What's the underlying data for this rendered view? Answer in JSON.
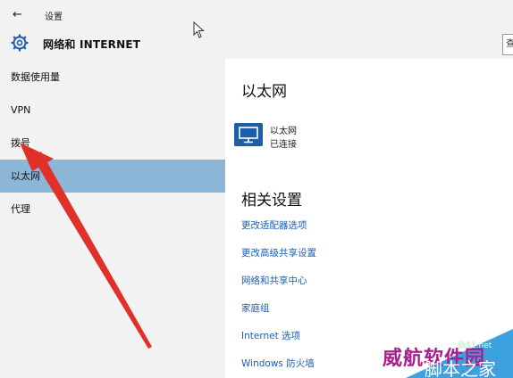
{
  "window": {
    "app_title": "设置",
    "section_title": "网络和 INTERNET",
    "back_icon": "back-arrow-icon",
    "gear_icon": "gear-icon"
  },
  "sidebar": {
    "items": [
      {
        "label": "数据使用量",
        "active": false
      },
      {
        "label": "VPN",
        "active": false
      },
      {
        "label": "拨号",
        "active": false
      },
      {
        "label": "以太网",
        "active": true
      },
      {
        "label": "代理",
        "active": false
      }
    ]
  },
  "search": {
    "edge_text": "查"
  },
  "main": {
    "heading": "以太网",
    "network": {
      "name": "以太网",
      "status": "已连接",
      "icon": "ethernet-monitor-icon"
    },
    "related_heading": "相关设置",
    "links": [
      "更改适配器选项",
      "更改高级共享设置",
      "网络和共享中心",
      "家庭组",
      "Internet 选项",
      "Windows 防火墙"
    ]
  },
  "watermark": {
    "cn": "威航软件园",
    "domain": "jb51.net",
    "sub": "脚本之家",
    "colors": {
      "purple": "#a7208e",
      "blue": "#3da0df"
    }
  },
  "annotation": {
    "arrow_color": "#e0302a"
  }
}
